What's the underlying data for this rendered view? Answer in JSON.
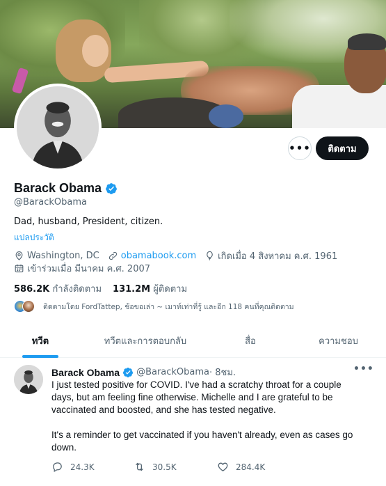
{
  "profile": {
    "name": "Barack Obama",
    "handle": "@BarackObama",
    "bio": "Dad, husband, President, citizen.",
    "translate_bio": "แปลประวัติ",
    "location": "Washington, DC",
    "website": "obamabook.com",
    "birthday": "เกิดเมื่อ 4 สิงหาคม ค.ศ. 1961",
    "joined": "เข้าร่วมเมื่อ มีนาคม ค.ศ. 2007",
    "following_count": "586.2K",
    "following_label": "กำลังติดตาม",
    "followers_count": "131.2M",
    "followers_label": "ผู้ติดตาม",
    "followed_by": "ติดตามโดย FordTattep, ช้อขอเล่า ~ เมาท์เท่าที่รู้ และอีก 118 คนที่คุณติดตาม"
  },
  "actions": {
    "more_label": "•••",
    "follow_label": "ติดตาม"
  },
  "tabs": [
    {
      "label": "ทวีต",
      "active": true
    },
    {
      "label": "ทวีตและการตอบกลับ",
      "active": false
    },
    {
      "label": "สื่อ",
      "active": false
    },
    {
      "label": "ความชอบ",
      "active": false
    }
  ],
  "tweet": {
    "author": "Barack Obama",
    "handle": "@BarackObama",
    "time": " · 8ชม.",
    "more_label": "•••",
    "paragraphs": [
      "I just tested positive for COVID. I've had a scratchy throat for a couple days, but am feeling fine otherwise. Michelle and I are grateful to be vaccinated and boosted, and she has tested negative.",
      "It's a reminder to get vaccinated if you haven't already, even as cases go down."
    ],
    "replies": "24.3K",
    "retweets": "30.5K",
    "likes": "284.4K"
  },
  "icons": {
    "verified": "verified-badge-icon",
    "location": "map-pin-icon",
    "link": "link-icon",
    "birthday": "balloon-icon",
    "joined": "calendar-icon",
    "reply": "reply-icon",
    "retweet": "retweet-icon",
    "like": "heart-icon"
  },
  "colors": {
    "accent": "#1d9bf0",
    "text": "#0f1419",
    "secondary_text": "#536471",
    "follow_button_bg": "#0f1419"
  }
}
